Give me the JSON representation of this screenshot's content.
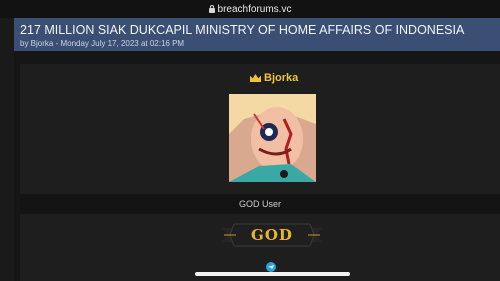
{
  "browser": {
    "url": "breachforums.vc",
    "lock_icon": "lock-icon"
  },
  "thread": {
    "title": "217 MILLION SIAK DUKCAPIL MINISTRY OF HOME AFFAIRS OF INDONESIA",
    "meta": "by Bjorka - Monday July 17, 2023 at 02:16 PM"
  },
  "post": {
    "username": "Bjorka",
    "username_icon": "crown-icon",
    "rank_title": "GOD User",
    "badge_text": "GOD",
    "contact_icon": "telegram-icon"
  },
  "colors": {
    "header_bg": "#3b4f74",
    "username": "#f0c23a",
    "badge_gold": "#e8b52e"
  }
}
